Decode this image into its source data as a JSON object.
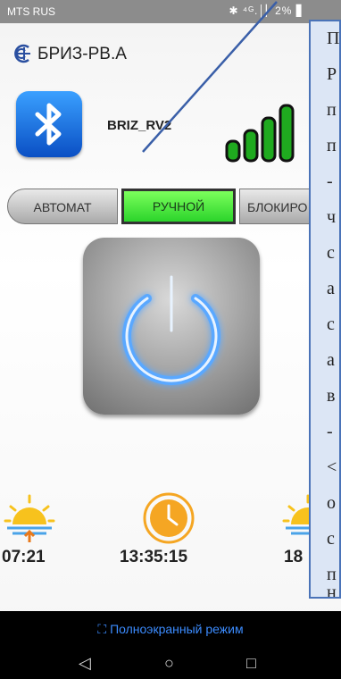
{
  "status_bar": {
    "carrier": "MTS RUS",
    "indicators": "✱ ⁴ᴳ.│▏2% ▋"
  },
  "header": {
    "logo_icon": "company-logo-icon",
    "title": "БРИЗ-РВ.А"
  },
  "device": {
    "name": "BRIZ_RV2",
    "bluetooth_icon": "bluetooth-icon",
    "signal_icon": "signal-strength-icon"
  },
  "mode_tabs": [
    {
      "label": "АВТОМАТ",
      "active": false
    },
    {
      "label": "РУЧНОЙ",
      "active": true
    },
    {
      "label": "БЛОКИРО",
      "active": false
    }
  ],
  "power_button_icon": "power-icon",
  "times": {
    "sunrise": "07:21",
    "current": "13:35:15",
    "sunset": "18"
  },
  "fullscreen": {
    "icon": "expand-icon",
    "label": "Полноэкранный режим"
  },
  "nav": {
    "back": "◁",
    "home": "○",
    "recent": "□"
  },
  "annotation": {
    "lines": [
      "П",
      "Р",
      "п",
      "п",
      "-",
      "ч",
      "с",
      "а",
      "с",
      "а",
      "в",
      "-",
      "<",
      "о",
      "с",
      "п",
      "н"
    ]
  },
  "colors": {
    "active_tab": "#4ee83a",
    "accent_blue": "#3c8cff",
    "annotation_bg": "#dce6f5",
    "annotation_border": "#4a73b8"
  }
}
